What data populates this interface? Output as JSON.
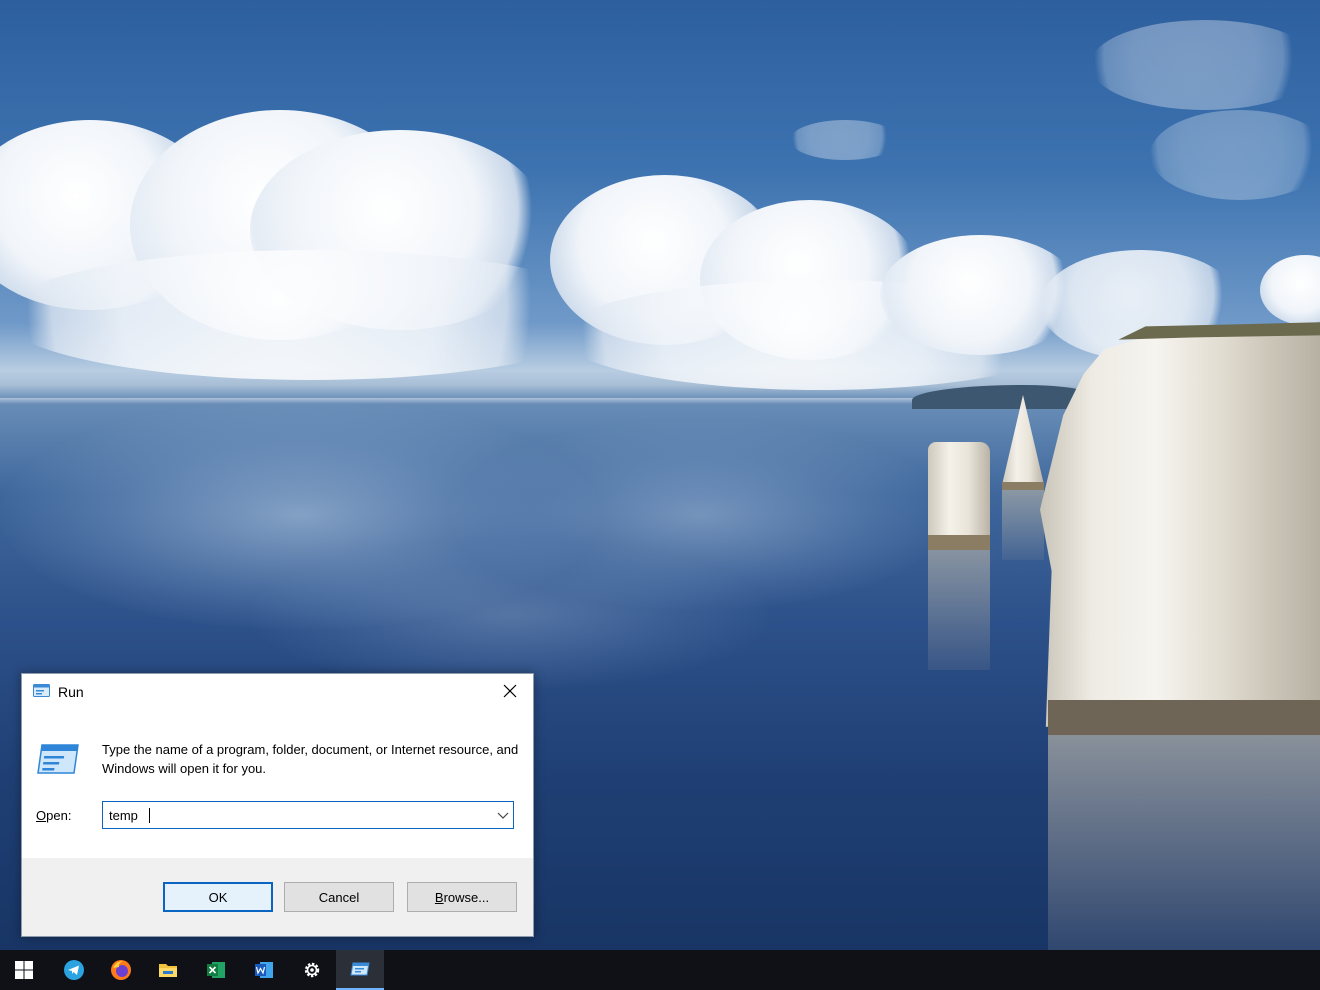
{
  "run_dialog": {
    "title": "Run",
    "description": "Type the name of a program, folder, document, or Internet resource, and Windows will open it for you.",
    "open_label_accel": "O",
    "open_label_rest": "pen:",
    "open_value": "temp",
    "ok_label": "OK",
    "cancel_label": "Cancel",
    "browse_label_accel": "B",
    "browse_label_rest": "rowse..."
  },
  "taskbar": {
    "items": [
      {
        "name": "start-button",
        "icon": "windows-logo-icon"
      },
      {
        "name": "telegram",
        "icon": "telegram-icon"
      },
      {
        "name": "firefox",
        "icon": "firefox-icon"
      },
      {
        "name": "file-explorer",
        "icon": "folder-icon"
      },
      {
        "name": "excel",
        "icon": "excel-icon"
      },
      {
        "name": "word",
        "icon": "word-icon"
      },
      {
        "name": "settings",
        "icon": "gear-icon"
      },
      {
        "name": "run",
        "icon": "run-icon",
        "active": true
      }
    ]
  },
  "colors": {
    "taskbar_bg": "#0f1117",
    "accent": "#0a64c2",
    "dialog_footer": "#f0f0f0"
  }
}
